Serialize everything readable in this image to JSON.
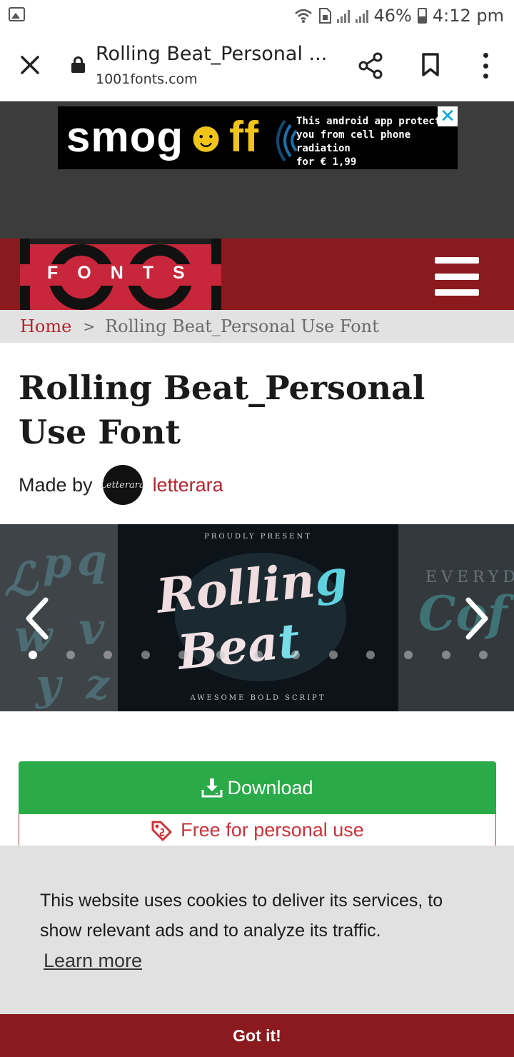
{
  "status_bar": {
    "battery": "46%",
    "time": "4:12 pm"
  },
  "browser": {
    "page_title": "Rolling Beat_Personal ...",
    "url": "1001fonts.com",
    "close_icon": "close-icon",
    "lock_icon": "lock-icon",
    "share_icon": "share-icon",
    "bookmark_icon": "bookmark-icon",
    "menu_icon": "more-vert-icon"
  },
  "ad": {
    "brand_main": "smog",
    "brand_face": "☻",
    "brand_off": "ff",
    "text_line1": "This android app protects",
    "text_line2": "you from cell phone radiation",
    "text_line3": "for € 1,99",
    "close": "✕"
  },
  "site": {
    "logo_text": "FONTS",
    "menu_icon": "hamburger-icon",
    "brand_color": "#8b1a1e"
  },
  "breadcrumb": {
    "home": "Home",
    "separator": ">",
    "current": "Rolling Beat_Personal Use Font"
  },
  "font": {
    "title": "Rolling Beat_Personal Use Font",
    "made_by_label": "Made by",
    "author": "letterara",
    "avatar_text": "Letterara"
  },
  "carousel": {
    "main_slide": {
      "kicker": "PROUDLY PRESENT",
      "word1": "Rollin",
      "word1_tail": "g",
      "word2": "Bea",
      "word2_tail": "t",
      "footer": "AWESOME BOLD SCRIPT"
    },
    "right_slide": {
      "heading": "EVERYD",
      "word": "Cof"
    },
    "dot_count": 13,
    "active_index": 0,
    "prev_icon": "chevron-left-icon",
    "next_icon": "chevron-right-icon"
  },
  "download": {
    "label": "Download",
    "icon": "download-icon",
    "color": "#2aaa48"
  },
  "license": {
    "label": "Free for personal use",
    "icon": "price-tag-icon",
    "color": "#c9343a"
  },
  "cookie": {
    "message": "This website uses cookies to deliver its services, to show relevant ads and to analyze its traffic.",
    "learn_more": "Learn more",
    "accept": "Got it!"
  }
}
